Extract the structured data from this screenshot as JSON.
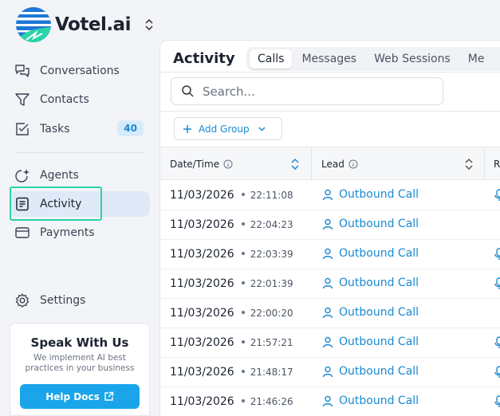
{
  "brand": {
    "name": "Votel.ai"
  },
  "nav": {
    "conversations": "Conversations",
    "contacts": "Contacts",
    "tasks": "Tasks",
    "tasks_count": "40",
    "agents": "Agents",
    "activity": "Activity",
    "payments": "Payments",
    "settings": "Settings"
  },
  "promo": {
    "title": "Speak With Us",
    "subtitle": "We implement AI best practices in your business",
    "button": "Help Docs"
  },
  "main": {
    "title": "Activity",
    "tabs": [
      "Calls",
      "Messages",
      "Web Sessions",
      "Me"
    ],
    "search_placeholder": "Search...",
    "add_group": "Add Group"
  },
  "table": {
    "headers": {
      "date": "Date/Time",
      "lead": "Lead",
      "r": "R"
    },
    "rows": [
      {
        "date": "11/03/2026",
        "time": "22:11:08",
        "lead": "Outbound Call",
        "mic": true
      },
      {
        "date": "11/03/2026",
        "time": "22:04:23",
        "lead": "Outbound Call",
        "mic": false
      },
      {
        "date": "11/03/2026",
        "time": "22:03:39",
        "lead": "Outbound Call",
        "mic": true
      },
      {
        "date": "11/03/2026",
        "time": "22:01:39",
        "lead": "Outbound Call",
        "mic": true
      },
      {
        "date": "11/03/2026",
        "time": "22:00:20",
        "lead": "Outbound Call",
        "mic": false
      },
      {
        "date": "11/03/2026",
        "time": "21:57:21",
        "lead": "Outbound Call",
        "mic": true
      },
      {
        "date": "11/03/2026",
        "time": "21:48:17",
        "lead": "Outbound Call",
        "mic": true
      },
      {
        "date": "11/03/2026",
        "time": "21:46:26",
        "lead": "Outbound Call",
        "mic": true
      }
    ]
  },
  "colors": {
    "accent": "#1a8ad0",
    "button": "#1aa5ea",
    "focus": "#2ad3a8",
    "active_nav": "#dfe9f7"
  }
}
